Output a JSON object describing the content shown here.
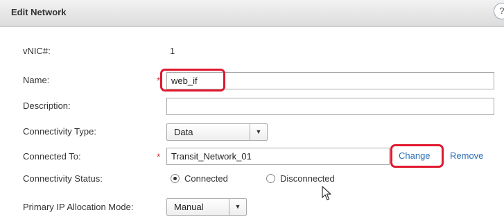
{
  "dialog": {
    "title": "Edit Network",
    "help_icon": "help-icon"
  },
  "fields": {
    "vnic": {
      "label": "vNIC#:",
      "value": "1"
    },
    "name": {
      "label": "Name:",
      "value": "web_if"
    },
    "description": {
      "label": "Description:",
      "value": ""
    },
    "connectivity_type": {
      "label": "Connectivity Type:",
      "value": "Data"
    },
    "connected_to": {
      "label": "Connected To:",
      "value": "Transit_Network_01",
      "change_label": "Change",
      "remove_label": "Remove"
    },
    "connectivity_status": {
      "label": "Connectivity Status:",
      "options": [
        "Connected",
        "Disconnected"
      ],
      "selected": "Connected"
    },
    "primary_ip_mode": {
      "label": "Primary IP Allocation Mode:",
      "value": "Manual"
    }
  },
  "required_marker": "*",
  "colors": {
    "highlight": "#e0182e",
    "link": "#2a6fb5",
    "required": "#d33c3c"
  }
}
